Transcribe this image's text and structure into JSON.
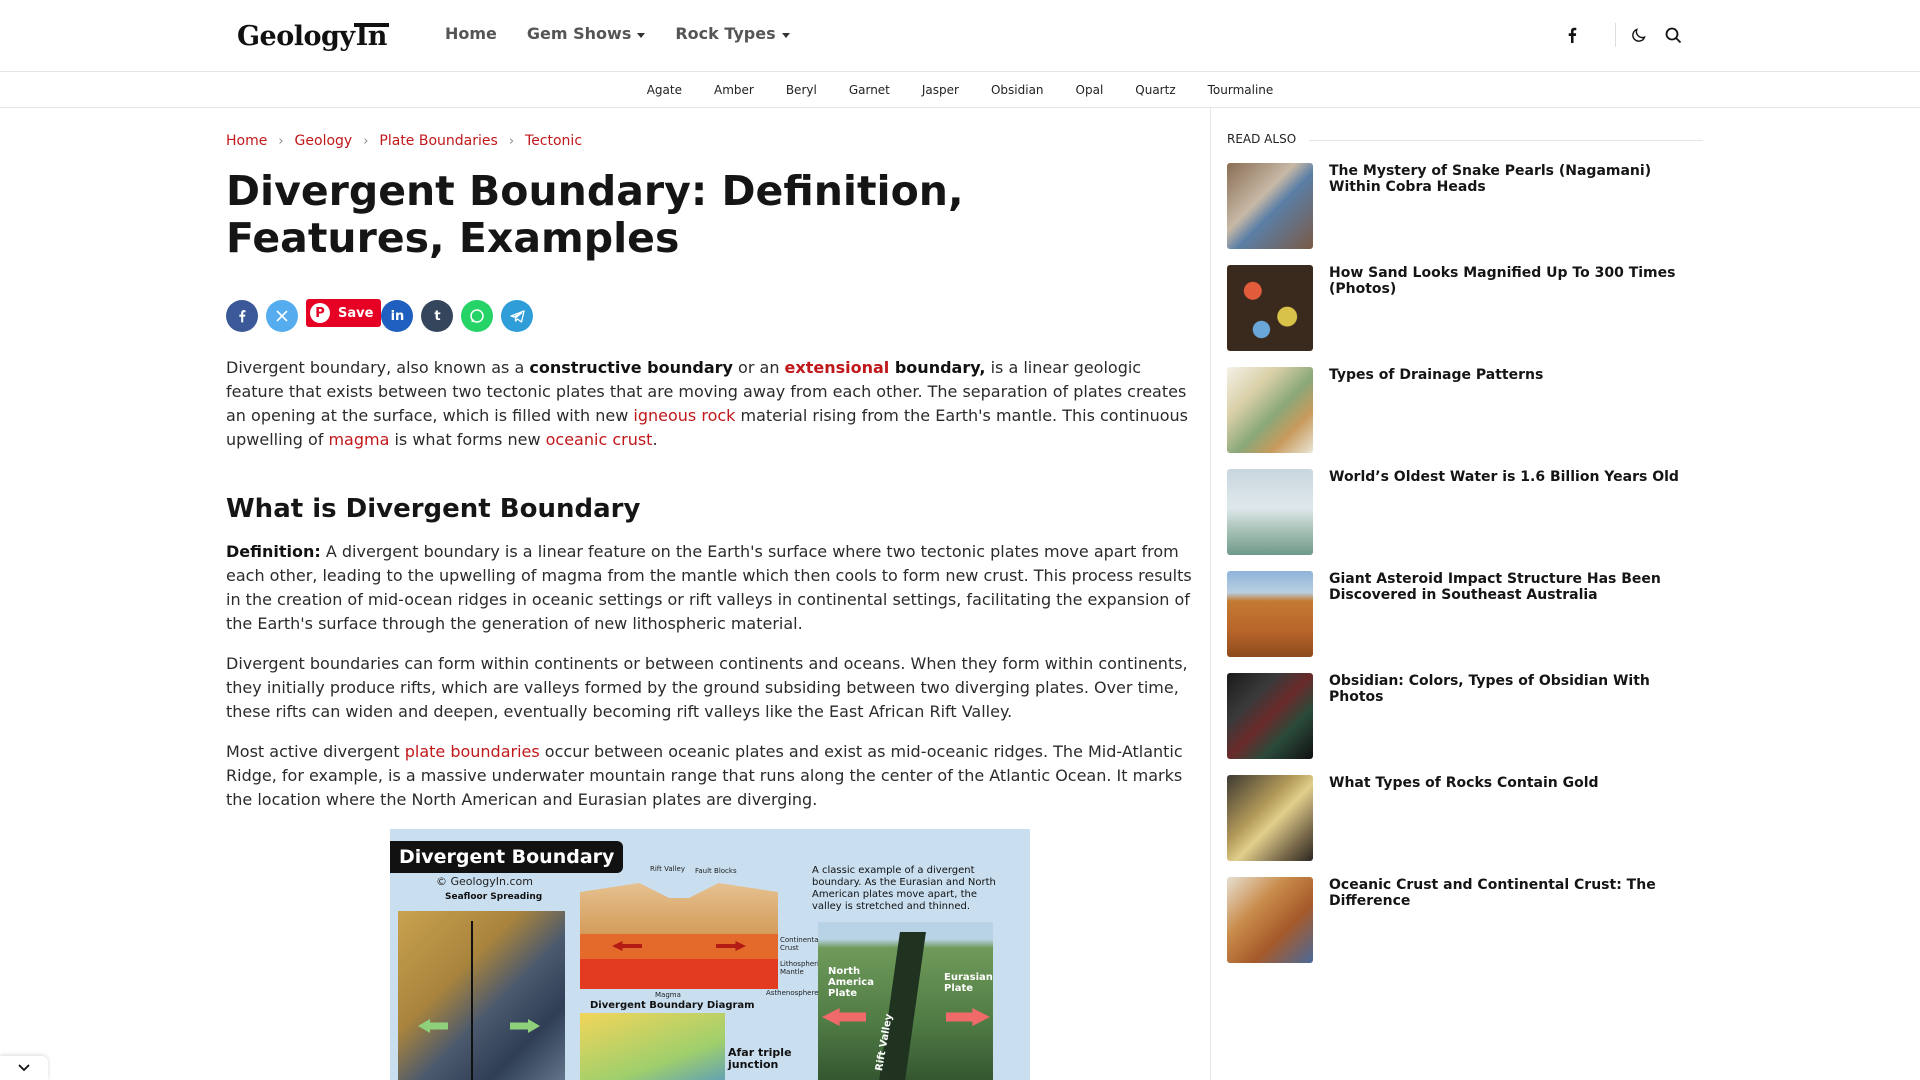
{
  "header": {
    "logo_main": "Geology",
    "logo_suffix": "In",
    "nav": [
      {
        "label": "Home",
        "has_dropdown": false
      },
      {
        "label": "Gem Shows",
        "has_dropdown": true
      },
      {
        "label": "Rock Types",
        "has_dropdown": true
      }
    ],
    "icons": [
      "facebook-icon",
      "moon-icon",
      "search-icon"
    ]
  },
  "subnav": [
    "Agate",
    "Amber",
    "Beryl",
    "Garnet",
    "Jasper",
    "Obsidian",
    "Opal",
    "Quartz",
    "Tourmaline"
  ],
  "breadcrumb": [
    "Home",
    "Geology",
    "Plate Boundaries",
    "Tectonic"
  ],
  "article": {
    "title": "Divergent Boundary: Definition, Features, Examples",
    "share": {
      "save_label": "Save",
      "buttons": [
        "facebook",
        "x",
        "pinterest",
        "linkedin",
        "tumblr",
        "whatsapp",
        "telegram"
      ],
      "colors": {
        "facebook": "#3b5998",
        "x": "#55acee",
        "pinterest": "#e60023",
        "linkedin": "#1e5fbf",
        "tumblr": "#35465c",
        "whatsapp": "#25d366",
        "telegram": "#2f9ed8"
      }
    },
    "intro": {
      "t1": "Divergent boundary, also known as a ",
      "b1": "constructive boundary",
      "t2": " or an ",
      "l1": "extensional",
      "b2": " boundary,",
      "t3": " is a linear geologic feature that exists between two tectonic plates that are moving away from each other. The separation of plates creates an opening at the surface, which is filled with new ",
      "l2": "igneous rock",
      "t4": " material rising from the Earth's mantle. This continuous upwelling of ",
      "l3": "magma",
      "t5": " is what forms new ",
      "l4": "oceanic crust",
      "t6": "."
    },
    "h2": "What is Divergent Boundary",
    "def": {
      "label": "Definition:",
      "text": " A divergent boundary is a linear feature on the Earth's surface where two tectonic plates move apart from each other, leading to the upwelling of magma from the mantle which then cools to form new crust. This process results in the creation of mid-ocean ridges in oceanic settings or rift valleys in continental settings, facilitating the expansion of the Earth's surface through the generation of new lithospheric material."
    },
    "p2": "Divergent boundaries can form within continents or between continents and oceans. When they form within continents, they initially produce rifts, which are valleys formed by the ground subsiding between two diverging plates. Over time, these rifts can widen and deepen, eventually becoming rift valleys like the East African Rift Valley.",
    "p3": {
      "t1": "Most active divergent ",
      "l1": "plate boundaries",
      "t2": " occur between oceanic plates and exist as mid-oceanic ridges. The Mid-Atlantic Ridge, for example, is a massive underwater mountain range that runs along the center of the Atlantic Ocean. It marks the location where the North American and Eurasian plates are diverging."
    },
    "figure": {
      "title": "Divergent Boundary",
      "copyright": "© GeologyIn.com",
      "seafloor": "Seafloor Spreading",
      "rift_valley": "Rift Valley",
      "fault_blocks": "Fault Blocks",
      "continental_crust": "Continental Crust",
      "lithospheric_mantle": "Lithospheric Mantle",
      "asthenosphere": "Asthenosphere",
      "magma": "Magma",
      "diagram_caption": "Divergent Boundary Diagram",
      "afar": "Afar triple junction",
      "note": "A classic example of a divergent boundary. As the Eurasian and North American plates move apart, the valley is stretched and thinned.",
      "north_america": "North America Plate",
      "eurasian": "Eurasian Plate",
      "rift_label": "Rift Valley"
    }
  },
  "sidebar": {
    "title": "READ ALSO",
    "items": [
      {
        "title": "The Mystery of Snake Pearls (Nagamani) Within Cobra Heads"
      },
      {
        "title": "How Sand Looks Magnified Up To 300 Times (Photos)"
      },
      {
        "title": "Types of Drainage Patterns"
      },
      {
        "title": "World’s Oldest Water is 1.6 Billion Years Old"
      },
      {
        "title": "Giant Asteroid Impact Structure Has Been Discovered in Southeast Australia"
      },
      {
        "title": "Obsidian: Colors, Types of Obsidian With Photos"
      },
      {
        "title": "What Types of Rocks Contain Gold"
      },
      {
        "title": "Oceanic Crust and Continental Crust: The Difference"
      }
    ]
  },
  "colors": {
    "link": "#c0181b",
    "text": "#2b2b2b",
    "heading": "#151515"
  }
}
